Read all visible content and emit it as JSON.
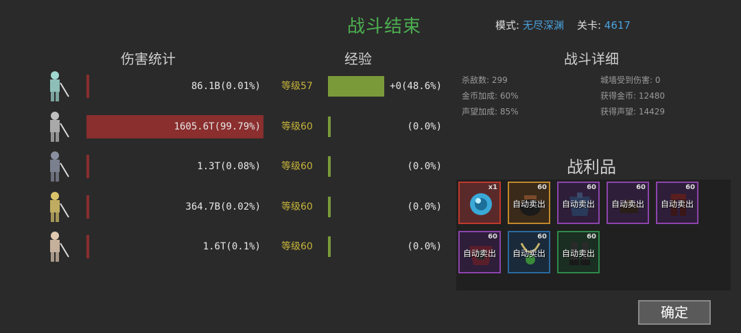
{
  "header": {
    "title": "战斗结束",
    "mode_label": "模式:",
    "mode_value": "无尽深渊",
    "stage_label": "关卡:",
    "stage_value": "4617"
  },
  "sections": {
    "damage": "伤害统计",
    "exp": "经验",
    "details": "战斗详细",
    "loot": "战利品"
  },
  "heroes": [
    {
      "damage": "86.1B(0.01%)",
      "damage_share": 0.0001,
      "level": "等级57",
      "xp_fill": 0.486,
      "xp": "+0(48.6%)",
      "color": "#9fd8d0"
    },
    {
      "damage": "1605.6T(99.79%)",
      "damage_share": 0.9979,
      "level": "等级60",
      "xp_fill": 0,
      "xp": "(0.0%)",
      "color": "#c0c0c0"
    },
    {
      "damage": "1.3T(0.08%)",
      "damage_share": 0.0008,
      "level": "等级60",
      "xp_fill": 0,
      "xp": "(0.0%)",
      "color": "#8a8fa0"
    },
    {
      "damage": "364.7B(0.02%)",
      "damage_share": 0.0002,
      "level": "等级60",
      "xp_fill": 0,
      "xp": "(0.0%)",
      "color": "#d9c36a"
    },
    {
      "damage": "1.6T(0.1%)",
      "damage_share": 0.001,
      "level": "等级60",
      "xp_fill": 0,
      "xp": "(0.0%)",
      "color": "#e0c8b0"
    }
  ],
  "details": {
    "kills": "杀敌数: 299",
    "gold_bonus": "金币加成: 60%",
    "fame_bonus": "声望加成: 85%",
    "wall_damage": "城墙受到伤害: 0",
    "gold_gained": "获得金币: 12480",
    "fame_gained": "获得声望: 14429"
  },
  "loot": [
    {
      "icon": "orb-icon",
      "count": "x1",
      "sell": "",
      "border": "#c0392b",
      "bg": "#5a2a2a"
    },
    {
      "icon": "pot-icon",
      "count": "60",
      "sell": "自动卖出",
      "border": "#c08a2a",
      "bg": "#3a2a1a"
    },
    {
      "icon": "armor-icon",
      "count": "60",
      "sell": "自动卖出",
      "border": "#8e44ad",
      "bg": "#2e1e3a"
    },
    {
      "icon": "helmet-icon",
      "count": "60",
      "sell": "自动卖出",
      "border": "#8e44ad",
      "bg": "#2e1e3a"
    },
    {
      "icon": "legs-icon",
      "count": "60",
      "sell": "自动卖出",
      "border": "#8e44ad",
      "bg": "#2e1e3a"
    },
    {
      "icon": "chest-icon",
      "count": "60",
      "sell": "自动卖出",
      "border": "#8e44ad",
      "bg": "#2e1e3a"
    },
    {
      "icon": "amulet-icon",
      "count": "60",
      "sell": "自动卖出",
      "border": "#2a6aa0",
      "bg": "#1a2a3a"
    },
    {
      "icon": "boots-icon",
      "count": "60",
      "sell": "自动卖出",
      "border": "#2e8b4a",
      "bg": "#1a2e22"
    }
  ],
  "confirm_label": "确定"
}
